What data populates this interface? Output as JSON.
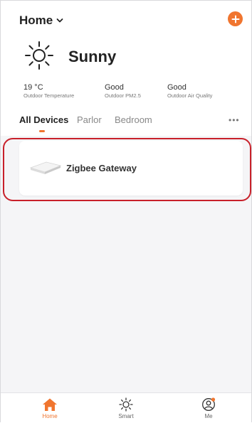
{
  "header": {
    "title": "Home"
  },
  "weather": {
    "condition": "Sunny"
  },
  "stats": [
    {
      "value": "19 °C",
      "label": "Outdoor Temperature"
    },
    {
      "value": "Good",
      "label": "Outdoor PM2.5"
    },
    {
      "value": "Good",
      "label": "Outdoor Air Quality"
    }
  ],
  "tabs": [
    {
      "label": "All Devices"
    },
    {
      "label": "Parlor"
    },
    {
      "label": "Bedroom"
    }
  ],
  "more": "•••",
  "devices": [
    {
      "name": "Zigbee Gateway"
    }
  ],
  "nav": [
    {
      "label": "Home"
    },
    {
      "label": "Smart"
    },
    {
      "label": "Me"
    }
  ],
  "colors": {
    "accent": "#f0752f",
    "highlight": "#c8202a",
    "background": "#f5f5f7"
  }
}
